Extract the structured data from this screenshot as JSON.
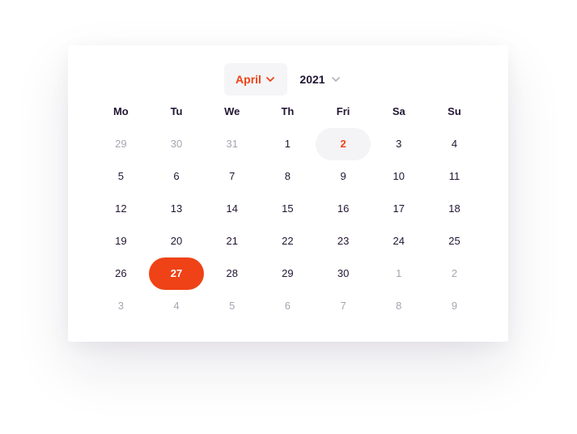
{
  "header": {
    "month": "April",
    "year": "2021"
  },
  "weekdays": [
    "Mo",
    "Tu",
    "We",
    "Th",
    "Fri",
    "Sa",
    "Su"
  ],
  "weeks": [
    [
      {
        "label": "29",
        "state": "muted"
      },
      {
        "label": "30",
        "state": "muted"
      },
      {
        "label": "31",
        "state": "muted"
      },
      {
        "label": "1",
        "state": "normal"
      },
      {
        "label": "2",
        "state": "today"
      },
      {
        "label": "3",
        "state": "normal"
      },
      {
        "label": "4",
        "state": "normal"
      }
    ],
    [
      {
        "label": "5",
        "state": "normal"
      },
      {
        "label": "6",
        "state": "normal"
      },
      {
        "label": "7",
        "state": "normal"
      },
      {
        "label": "8",
        "state": "normal"
      },
      {
        "label": "9",
        "state": "normal"
      },
      {
        "label": "10",
        "state": "normal"
      },
      {
        "label": "11",
        "state": "normal"
      }
    ],
    [
      {
        "label": "12",
        "state": "normal"
      },
      {
        "label": "13",
        "state": "normal"
      },
      {
        "label": "14",
        "state": "normal"
      },
      {
        "label": "15",
        "state": "normal"
      },
      {
        "label": "16",
        "state": "normal"
      },
      {
        "label": "17",
        "state": "normal"
      },
      {
        "label": "18",
        "state": "normal"
      }
    ],
    [
      {
        "label": "19",
        "state": "normal"
      },
      {
        "label": "20",
        "state": "normal"
      },
      {
        "label": "21",
        "state": "normal"
      },
      {
        "label": "22",
        "state": "normal"
      },
      {
        "label": "23",
        "state": "normal"
      },
      {
        "label": "24",
        "state": "normal"
      },
      {
        "label": "25",
        "state": "normal"
      }
    ],
    [
      {
        "label": "26",
        "state": "normal"
      },
      {
        "label": "27",
        "state": "selected"
      },
      {
        "label": "28",
        "state": "normal"
      },
      {
        "label": "29",
        "state": "normal"
      },
      {
        "label": "30",
        "state": "normal"
      },
      {
        "label": "1",
        "state": "muted"
      },
      {
        "label": "2",
        "state": "muted"
      }
    ],
    [
      {
        "label": "3",
        "state": "muted"
      },
      {
        "label": "4",
        "state": "muted"
      },
      {
        "label": "5",
        "state": "muted"
      },
      {
        "label": "6",
        "state": "muted"
      },
      {
        "label": "7",
        "state": "muted"
      },
      {
        "label": "8",
        "state": "muted"
      },
      {
        "label": "9",
        "state": "muted"
      }
    ]
  ],
  "icons": {
    "month_chevron": "chevron-down-icon",
    "year_chevron": "chevron-down-icon"
  },
  "colors": {
    "accent": "#ef4216",
    "text": "#221532",
    "muted": "#a8a4b1",
    "today_bg": "#f4f3f6"
  }
}
